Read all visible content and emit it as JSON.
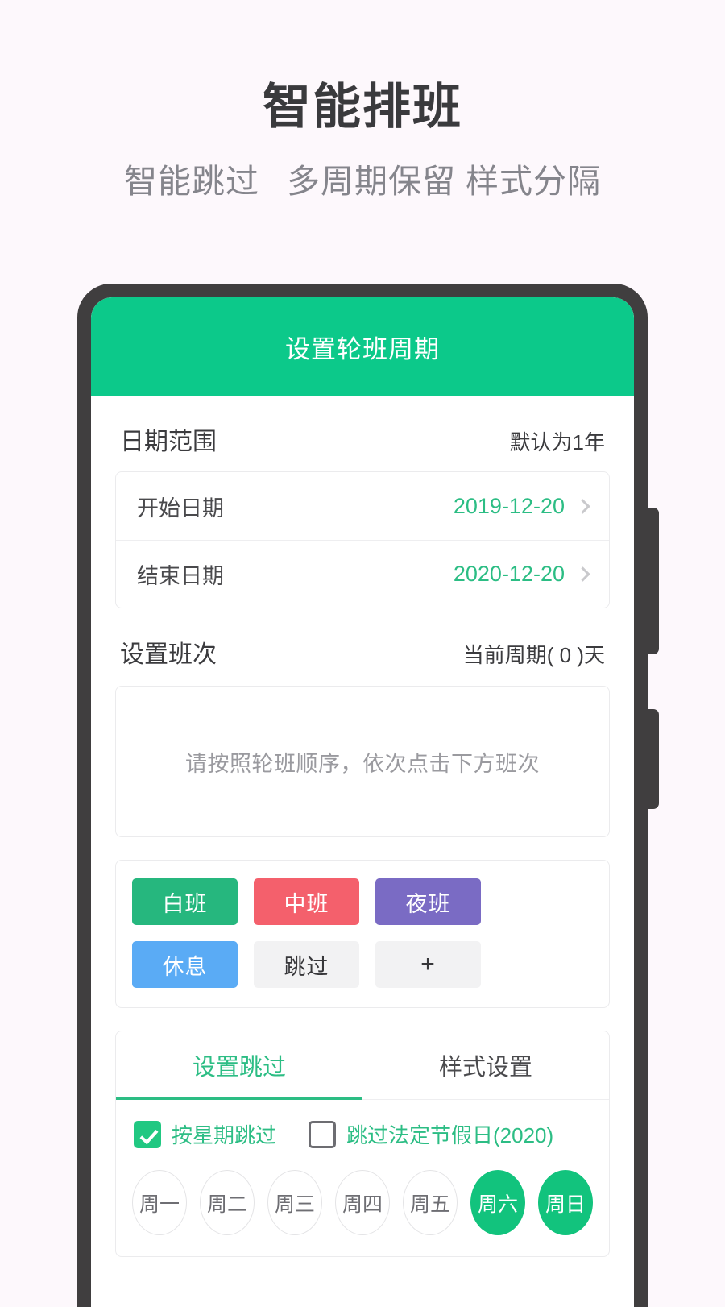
{
  "promo": {
    "title": "智能排班",
    "subtitle_parts": [
      "智能跳过",
      "多周期保留",
      "样式分隔"
    ]
  },
  "colors": {
    "brand_green": "#0cc98a",
    "accent_green": "#2cbd84",
    "chip_green": "#12c37d",
    "day_shift": "#26b77e",
    "mid_shift": "#f4606c",
    "night_shift": "#7a6bc4",
    "rest_shift": "#5aabf5",
    "neutral_chip": "#f2f2f3",
    "page_bg": "#fdf8fc",
    "phone_frame": "#403e3f"
  },
  "appbar": {
    "title": "设置轮班周期"
  },
  "date_range": {
    "section_title": "日期范围",
    "section_note": "默认为1年",
    "rows": [
      {
        "label": "开始日期",
        "value": "2019-12-20"
      },
      {
        "label": "结束日期",
        "value": "2020-12-20"
      }
    ]
  },
  "shift_setup": {
    "section_title": "设置班次",
    "section_note": "当前周期( 0 )天",
    "placeholder": "请按照轮班顺序，依次点击下方班次",
    "buttons": [
      {
        "label": "白班",
        "color": "#26b77e",
        "style": "filled"
      },
      {
        "label": "中班",
        "color": "#f4606c",
        "style": "filled"
      },
      {
        "label": "夜班",
        "color": "#7a6bc4",
        "style": "filled"
      },
      {
        "label": "休息",
        "color": "#5aabf5",
        "style": "filled"
      },
      {
        "label": "跳过",
        "color": "#f2f2f3",
        "style": "plain"
      },
      {
        "label": "+",
        "color": "#f2f2f3",
        "style": "plain"
      }
    ]
  },
  "skip_panel": {
    "tabs": [
      {
        "label": "设置跳过",
        "active": true
      },
      {
        "label": "样式设置",
        "active": false
      }
    ],
    "checkboxes": [
      {
        "label": "按星期跳过",
        "checked": true
      },
      {
        "label": "跳过法定节假日(2020)",
        "checked": false
      }
    ],
    "weekdays": [
      {
        "label": "周一",
        "selected": false
      },
      {
        "label": "周二",
        "selected": false
      },
      {
        "label": "周三",
        "selected": false
      },
      {
        "label": "周四",
        "selected": false
      },
      {
        "label": "周五",
        "selected": false
      },
      {
        "label": "周六",
        "selected": true
      },
      {
        "label": "周日",
        "selected": true
      }
    ]
  }
}
